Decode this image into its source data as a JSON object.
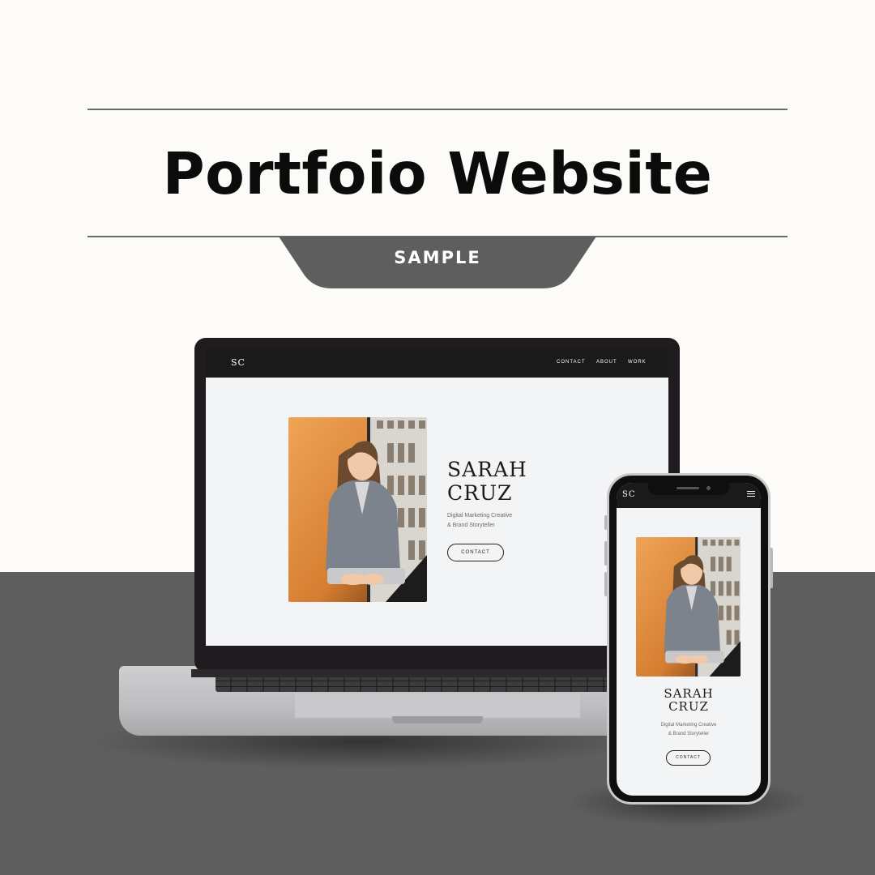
{
  "header": {
    "title": "Portfoio Website",
    "tab_label": "SAMPLE"
  },
  "colors": {
    "background": "#fcfbf7",
    "floor": "#5e5e5e",
    "tab": "#5e5e5e",
    "rule": "#6b6b66",
    "nav": "#1a1a1a",
    "screen": "#f3f4f5",
    "photo_orange": "#e08a3c"
  },
  "laptop": {
    "logo": "SC",
    "nav_links": [
      "CONTACT",
      "ABOUT",
      "WORK"
    ],
    "name_line1": "SARAH",
    "name_line2": "CRUZ",
    "subtitle_line1": "Digital Marketing Creative",
    "subtitle_line2": "& Brand Storyteller",
    "button_label": "CONTACT"
  },
  "phone": {
    "logo": "SC",
    "menu_icon": "hamburger-menu-icon",
    "name_line1": "SARAH",
    "name_line2": "CRUZ",
    "subtitle_line1": "Digital Marketing Creative",
    "subtitle_line2": "& Brand Storyteller",
    "button_label": "CONTACT"
  }
}
